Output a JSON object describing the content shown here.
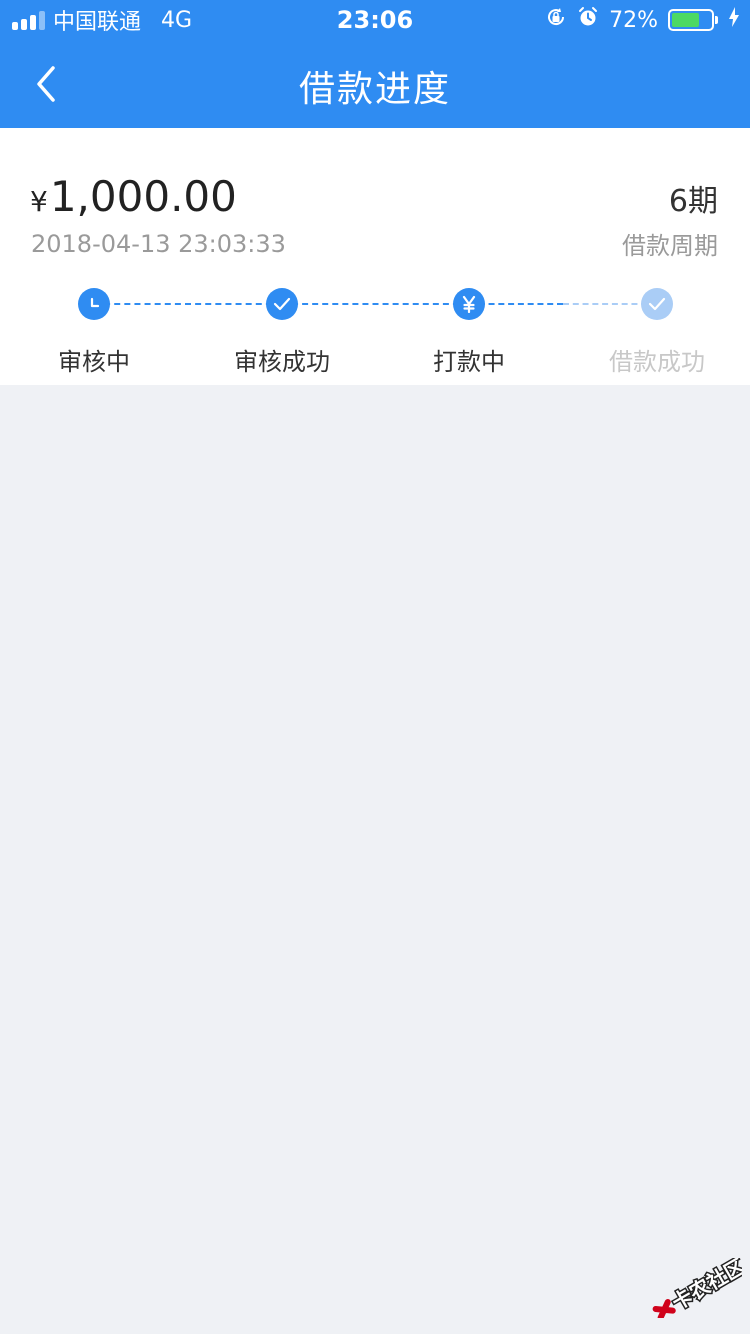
{
  "status_bar": {
    "carrier": "中国联通",
    "network": "4G",
    "time": "23:06",
    "battery_text": "72%",
    "battery_level": 0.72
  },
  "nav": {
    "title": "借款进度",
    "back_icon": "chevron-left-icon"
  },
  "loan": {
    "currency": "¥",
    "amount": "1,000.00",
    "datetime": "2018-04-13 23:03:33",
    "period_value": "6期",
    "period_label": "借款周期"
  },
  "steps": [
    {
      "label": "审核中",
      "icon": "clock-icon",
      "active": true
    },
    {
      "label": "审核成功",
      "icon": "check-icon",
      "active": true
    },
    {
      "label": "打款中",
      "icon": "yen-icon",
      "active": true
    },
    {
      "label": "借款成功",
      "icon": "check-icon",
      "active": false
    }
  ],
  "watermark": {
    "text": "卡农社区"
  },
  "colors": {
    "primary": "#2f8cf2",
    "primary_faint": "#aacdf6",
    "background": "#eff1f5",
    "battery": "#4cd964"
  }
}
